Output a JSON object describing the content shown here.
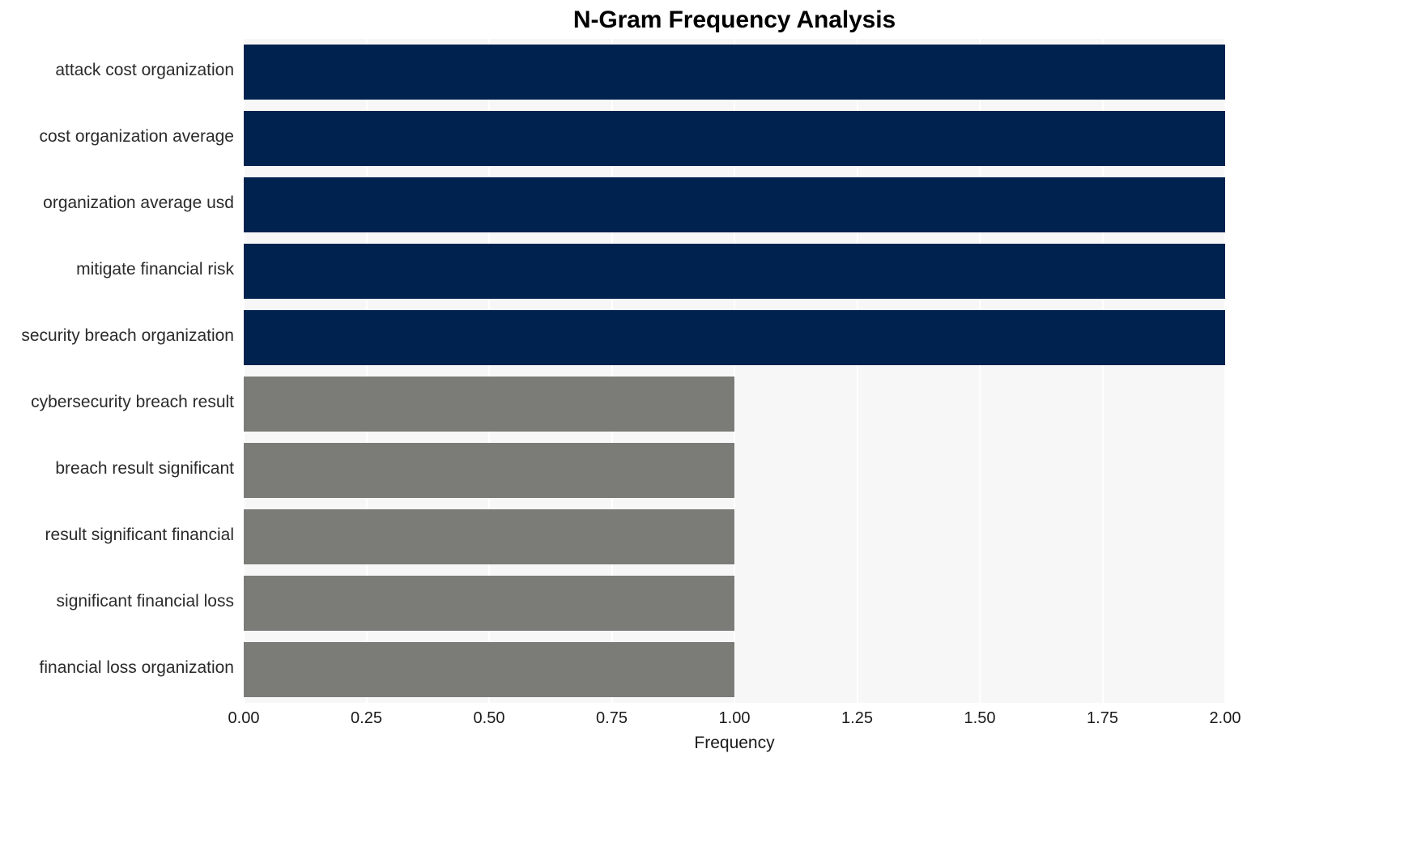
{
  "chart_data": {
    "type": "bar",
    "orientation": "horizontal",
    "title": "N-Gram Frequency Analysis",
    "xlabel": "Frequency",
    "ylabel": "",
    "categories": [
      "attack cost organization",
      "cost organization average",
      "organization average usd",
      "mitigate financial risk",
      "security breach organization",
      "cybersecurity breach result",
      "breach result significant",
      "result significant financial",
      "significant financial loss",
      "financial loss organization"
    ],
    "values": [
      2,
      2,
      2,
      2,
      2,
      1,
      1,
      1,
      1,
      1
    ],
    "bar_colors": [
      "#00224f",
      "#00224f",
      "#00224f",
      "#00224f",
      "#00224f",
      "#7b7b78",
      "#7b7b78",
      "#7b7b78",
      "#7b7b78",
      "#7b7b78"
    ],
    "xlim": [
      0,
      2
    ],
    "xticks": [
      0,
      0.25,
      0.5,
      0.75,
      1,
      1.25,
      1.5,
      1.75,
      2
    ],
    "xticklabels": [
      "0.00",
      "0.25",
      "0.50",
      "0.75",
      "1.00",
      "1.25",
      "1.50",
      "1.75",
      "2.00"
    ],
    "grid": true,
    "grid_axis": "x",
    "grid_color": "#ffffff",
    "plot_background": "#f7f7f7",
    "figure_background": "#ffffff",
    "legend": null,
    "legend_position": "none"
  },
  "colors": {
    "primary_bar": "#00224f",
    "secondary_bar": "#7b7b78",
    "plot_bg": "#f7f7f7",
    "grid": "#ffffff",
    "text": "#1a1a1a",
    "ylabel_text": "#2b2b2b"
  }
}
